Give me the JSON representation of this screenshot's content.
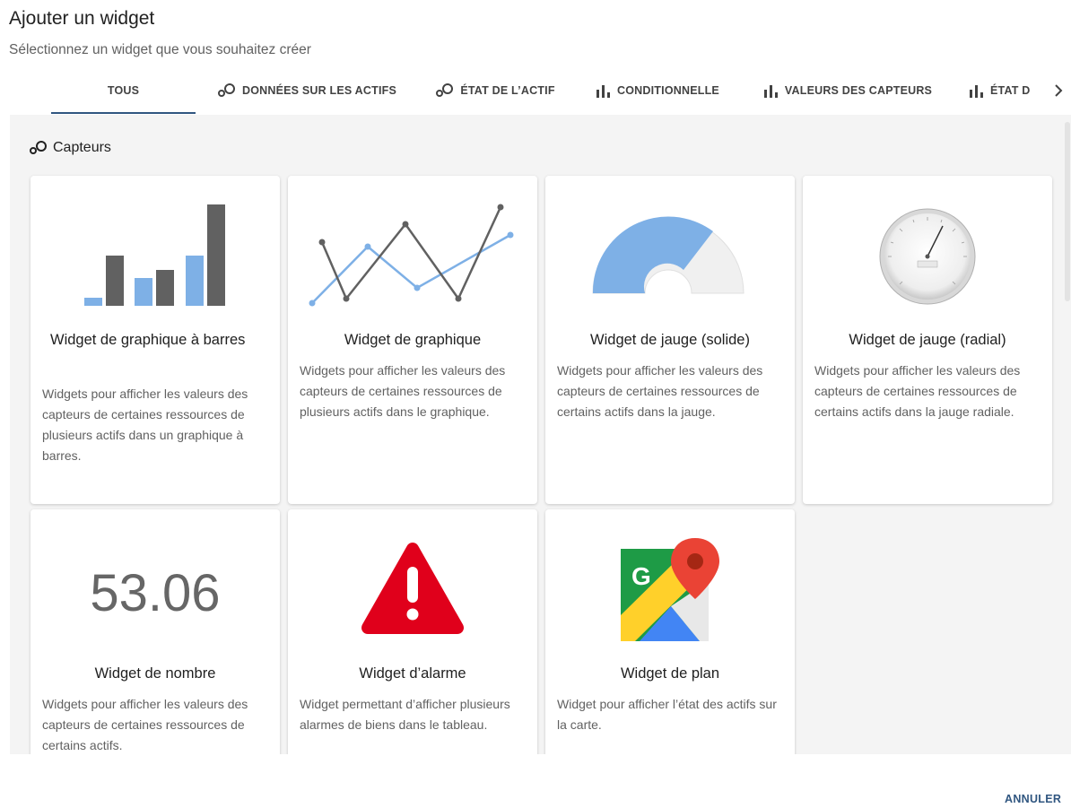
{
  "dialog": {
    "title": "Ajouter un widget",
    "subtitle": "Sélectionnez un widget que vous souhaitez créer",
    "cancel_label": "ANNULER"
  },
  "tabs": [
    {
      "label": "TOUS",
      "icon": "none",
      "active": true
    },
    {
      "label": "DONNÉES SUR LES ACTIFS",
      "icon": "bubbles-icon"
    },
    {
      "label": "ÉTAT DE L’ACTIF",
      "icon": "bubbles-icon"
    },
    {
      "label": "CONDITIONNELLE",
      "icon": "bar-chart-icon"
    },
    {
      "label": "VALEURS DES CAPTEURS",
      "icon": "bar-chart-icon"
    },
    {
      "label": "ÉTAT D",
      "icon": "bar-chart-icon"
    }
  ],
  "section": {
    "title": "Capteurs",
    "icon": "bubbles-icon"
  },
  "cards": [
    {
      "title": "Widget de graphique à barres",
      "description": "Widgets pour afficher les valeurs des capteurs de certaines ressources de plusieurs actifs dans un graphique à barres.",
      "preview": "bar-chart-preview"
    },
    {
      "title": "Widget de graphique",
      "description": "Widgets pour afficher les valeurs des capteurs de certaines ressources de plusieurs actifs dans le graphique.",
      "preview": "line-chart-preview"
    },
    {
      "title": "Widget de jauge (solide)",
      "description": "Widgets pour afficher les valeurs des capteurs de certaines ressources de certains actifs dans la jauge.",
      "preview": "solid-gauge-preview"
    },
    {
      "title": "Widget de jauge (radial)",
      "description": "Widgets pour afficher les valeurs des capteurs de certaines ressources de certains actifs dans la jauge radiale.",
      "preview": "radial-gauge-preview"
    },
    {
      "title": "Widget de nombre",
      "description": "Widgets pour afficher les valeurs des capteurs de certaines ressources de certains actifs.",
      "preview": "number-preview",
      "number": "53.06"
    },
    {
      "title": "Widget d’alarme",
      "description": "Widget permettant d’afficher plusieurs alarmes de biens dans le tableau.",
      "preview": "alarm-icon"
    },
    {
      "title": "Widget de plan",
      "description": "Widget pour afficher l’état des actifs sur la carte.",
      "preview": "map-icon"
    }
  ],
  "colors": {
    "accent": "#305680",
    "bar_dark": "#616161",
    "bar_light": "#7eb0e6",
    "alarm_red": "#e0001b"
  }
}
